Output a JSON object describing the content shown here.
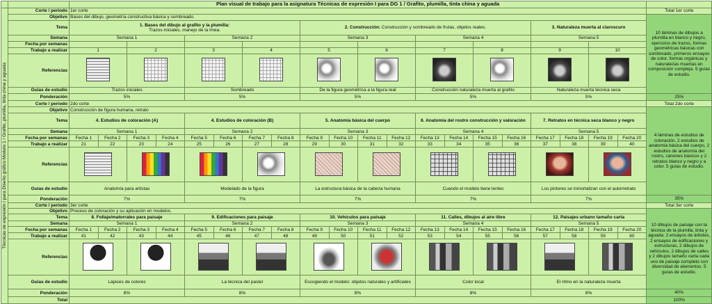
{
  "title": "Plan visual de trabajo para la asignatura Técnicas de expresión I para DG 1 / Grafito, plumilla, tinta china y aguada",
  "side_label": "Técnicas de expresión I para Diseño gráfico Modelo 1 / Grafito, plumilla, tinta china y aguada",
  "labels": {
    "corte": "Corte / periodo",
    "objetivo": "Objetivo",
    "tema": "Tema",
    "semana": "Semana",
    "fecha_semanas": "Fecha por semanas",
    "trabajo": "Trabajo a realizar",
    "referencias": "Referencias",
    "guias": "Guías de estudio",
    "ponderacion": "Ponderación",
    "total": "Total"
  },
  "grand_total": "100%",
  "cortes": [
    {
      "periodo": "1er corte",
      "total_title": "Total 1er corte",
      "objetivo": "Bases del dibujo, geometría constructiva básica y sombreado.",
      "temas": [
        {
          "bold": "1. Bases del dibujo al grafito y la plumilla:",
          "rest": "Trazos iniciales, manejo de la línea."
        },
        {
          "bold": "2. Construcción:",
          "rest": " Construcción y sombreado de frutas, objetos reales."
        },
        {
          "bold": "3. Naturaleza muerta al claroscuro",
          "rest": ""
        }
      ],
      "semanas": [
        "Semana 1",
        "Semana 2",
        "Semana 3",
        "Semana 4",
        "Semana 5"
      ],
      "fechas": [
        "",
        "",
        "",
        "",
        "",
        "",
        "",
        "",
        "",
        ""
      ],
      "trabajos": [
        "1",
        "2",
        "3",
        "4",
        "5",
        "6",
        "7",
        "8",
        "9",
        "10"
      ],
      "guias": [
        "Trazos iniciales",
        "Sombreado",
        "De la figura geométrica a la figura real",
        "Construcción naturaleza muerta al grafito",
        "Naturaleza muerta técnica seca"
      ],
      "ponderaciones": [
        "5%",
        "5%",
        "5%",
        "5%",
        "5%"
      ],
      "total_desc": "10 láminas de dibujos a plumilla en blanco y negro, ejercicios de trazos, formas geométricas básicas con sombreado, primeros ensayos de color, formas orgánicas y naturalezas muertas en composición compleja. 5 guías de estudio.",
      "total_pct": "25%"
    },
    {
      "periodo": "2do corte",
      "total_title": "Total 2do corte",
      "objetivo": "Construcción de figura humana, retrato",
      "temas": [
        {
          "bold": "4. Estudios de coloración (A)",
          "rest": ""
        },
        {
          "bold": "4. Estudios de coloración (B)",
          "rest": ""
        },
        {
          "bold": "5. Anatomía básica del cuerpo",
          "rest": ""
        },
        {
          "bold": "6. Anatomía del rostro construcción y valoración",
          "rest": ""
        },
        {
          "bold": "7. Retratos en técnica seca blanco y negro",
          "rest": ""
        }
      ],
      "semanas": [
        "Semana 1",
        "Semana 2",
        "Semana 3",
        "Semana 4",
        "Semana 5"
      ],
      "fechas": [
        "Fecha 1",
        "Fecha 2",
        "Fecha 3",
        "Fecha 4",
        "Fecha 5",
        "Fecha 6",
        "Fecha 7",
        "Fecha 8",
        "Fecha 9",
        "Fecha 10",
        "Fecha 11",
        "Fecha 12",
        "Fecha 13",
        "Fecha 14",
        "Fecha 15",
        "Fecha 16",
        "Fecha 17",
        "Fecha 18",
        "Fecha 19",
        "Fecha 20"
      ],
      "trabajos": [
        "21",
        "22",
        "23",
        "24",
        "25",
        "26",
        "27",
        "28",
        "29",
        "30",
        "31",
        "32",
        "33",
        "34",
        "35",
        "36",
        "37",
        "38",
        "39",
        "40"
      ],
      "guias": [
        "Anatomía para artistas",
        "Modelado de la figura",
        "La estructura básica de la cabeza humana",
        "Cuando el modelo tiene lentes",
        "Los pintores se inmortalizan con el autorretrato"
      ],
      "ponderaciones": [
        "7%",
        "7%",
        "7%",
        "7%",
        "7%"
      ],
      "total_desc": "4 láminas de estudios de coloración, 2 estudios de anatomía básica del cuerpo, 2 estudios de anatomía del rostro, cánones básicos y 2 retratos blanco y negro y a color. 5 guías de estudio.",
      "total_pct": "35%"
    },
    {
      "periodo": "3er corte",
      "total_title": "Total 3er corte",
      "objetivo": "Proceso de coloración y su aplicación en modelos.",
      "temas": [
        {
          "bold": "8. Follaje/matorrales para paisaje",
          "rest": ""
        },
        {
          "bold": "9. Edificaciones para paisaje",
          "rest": ""
        },
        {
          "bold": "10. Vehículos para paisaje",
          "rest": ""
        },
        {
          "bold": "11. Calles, dibujos al aire libre",
          "rest": ""
        },
        {
          "bold": "12. Paisajes urbano tamaño carta",
          "rest": ""
        }
      ],
      "semanas": [
        "Semana 1",
        "Semana 2",
        "Semana 3",
        "Semana 4",
        "Semana 5"
      ],
      "fechas": [
        "Fecha 1",
        "Fecha 2",
        "Fecha 3",
        "Fecha 4",
        "Fecha 5",
        "Fecha 6",
        "Fecha 7",
        "Fecha 8",
        "Fecha 9",
        "Fecha 10",
        "Fecha 11",
        "Fecha 12",
        "Fecha 13",
        "Fecha 14",
        "Fecha 15",
        "Fecha 16",
        "Fecha 17",
        "Fecha 18",
        "Fecha 19",
        "Fecha 20"
      ],
      "trabajos": [
        "41",
        "42",
        "43",
        "44",
        "45",
        "46",
        "47",
        "48",
        "49",
        "50",
        "51",
        "52",
        "53",
        "54",
        "55",
        "56",
        "57",
        "58",
        "59",
        "60"
      ],
      "guias": [
        "Lápices de colores",
        "La técnica del pastel",
        "Escogiendo el modelo: objetos naturales y artificiales",
        "Color local",
        "El ritmo en la naturaleza muerta"
      ],
      "ponderaciones": [
        "8%",
        "8%",
        "8%",
        "8%",
        "8%"
      ],
      "total_desc": "10 dibujos de paisaje con la técnica de la plumilla, tinta y aguada: 2 ensayos de árboles, 2 ensayos de edificaciones y estructuras, 2 dibujos de vehículos, 2 dibujos de calles y 2 dibujos tamaño carta cada uno de paisaje completo con diversidad de elementos. 5 guías de estudio.",
      "total_pct": "40%"
    }
  ],
  "reference_icons": {
    "corte1": [
      "grid-sketch-icon",
      "shading-sheet-icon",
      "object-shading-icon",
      "still-life-icon",
      "still-life-dark-icon"
    ],
    "corte2": [
      "color-swatch-icon",
      "color-sphere-icon",
      "anatomy-sketch-icon",
      "heads-grid-icon",
      "portrait-icon"
    ],
    "corte3": [
      "tree-drawing-icon",
      "building-drawing-icon",
      "car-drawing-icon",
      "street-drawing-icon",
      "urban-landscape-icon"
    ]
  }
}
